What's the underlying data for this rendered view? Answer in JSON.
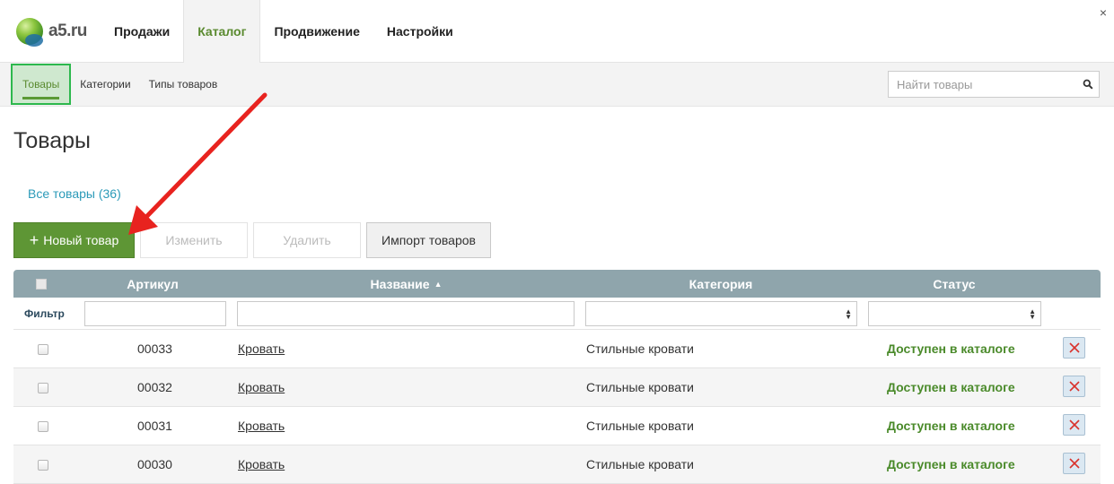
{
  "app": {
    "logo_text": "a5.ru",
    "close": "×"
  },
  "topnav": {
    "items": [
      {
        "label": "Продажи"
      },
      {
        "label": "Каталог",
        "active": true
      },
      {
        "label": "Продвижение"
      },
      {
        "label": "Настройки"
      }
    ]
  },
  "subnav": {
    "items": [
      {
        "label": "Товары",
        "active": true
      },
      {
        "label": "Категории"
      },
      {
        "label": "Типы товаров"
      }
    ],
    "search_placeholder": "Найти товары"
  },
  "page": {
    "title": "Товары",
    "all_link": "Все товары (36)"
  },
  "toolbar": {
    "new_plus": "+",
    "new_label": "Новый товар",
    "edit_label": "Изменить",
    "delete_label": "Удалить",
    "import_label": "Импорт товаров"
  },
  "table": {
    "headers": {
      "sku": "Артикул",
      "name": "Название",
      "sort_arrow": "▲",
      "category": "Категория",
      "status": "Статус"
    },
    "filter_label": "Фильтр",
    "rows": [
      {
        "sku": "00033",
        "name": "Кровать",
        "category": "Стильные кровати",
        "status": "Доступен в каталоге"
      },
      {
        "sku": "00032",
        "name": "Кровать",
        "category": "Стильные кровати",
        "status": "Доступен в каталоге"
      },
      {
        "sku": "00031",
        "name": "Кровать",
        "category": "Стильные кровати",
        "status": "Доступен в каталоге"
      },
      {
        "sku": "00030",
        "name": "Кровать",
        "category": "Стильные кровати",
        "status": "Доступен в каталоге"
      }
    ]
  },
  "colors": {
    "accent_green": "#5e9635",
    "link_blue": "#2b9ab8",
    "header_gray": "#8fa5ac",
    "annotation_red": "#e8231f"
  },
  "icons": {
    "search": "search-icon",
    "delete_row": "close-icon",
    "select_arrows": "select-arrows-icon"
  }
}
